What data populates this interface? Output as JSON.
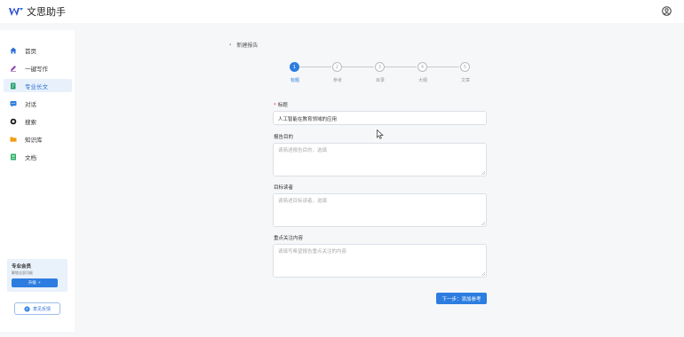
{
  "app": {
    "title": "文思助手"
  },
  "sidebar": {
    "items": [
      {
        "label": "首页",
        "icon": "home-icon"
      },
      {
        "label": "一键写作",
        "icon": "pen-icon"
      },
      {
        "label": "专业长文",
        "icon": "document-edit-icon",
        "active": true
      },
      {
        "label": "对话",
        "icon": "chat-icon"
      },
      {
        "label": "搜索",
        "icon": "search-icon"
      },
      {
        "label": "知识库",
        "icon": "folder-icon"
      },
      {
        "label": "文档",
        "icon": "document-list-icon"
      }
    ],
    "promo": {
      "title": "专业会员",
      "subtitle": "解锁全部功能",
      "button": "升级"
    },
    "feedback_label": "意见反馈"
  },
  "main": {
    "back_label": "新建报告",
    "steps": [
      {
        "number": "1",
        "label": "标题",
        "active": true
      },
      {
        "number": "2",
        "label": "参考",
        "active": false
      },
      {
        "number": "3",
        "label": "目录",
        "active": false
      },
      {
        "number": "4",
        "label": "大纲",
        "active": false
      },
      {
        "number": "5",
        "label": "文章",
        "active": false
      }
    ],
    "form": {
      "title_label": "标题",
      "title_value": "人工智能在教育领域的应用",
      "purpose_label": "报告目的",
      "purpose_placeholder": "请简述报告目的，选填",
      "readers_label": "目标读者",
      "readers_placeholder": "请简述目标读者，选填",
      "focus_label": "重点关注内容",
      "focus_placeholder": "请填写希望报告重点关注的内容"
    },
    "next_button": "下一步：添加参考"
  },
  "colors": {
    "accent": "#2d7de0",
    "active_bg": "#e8f1fb"
  }
}
